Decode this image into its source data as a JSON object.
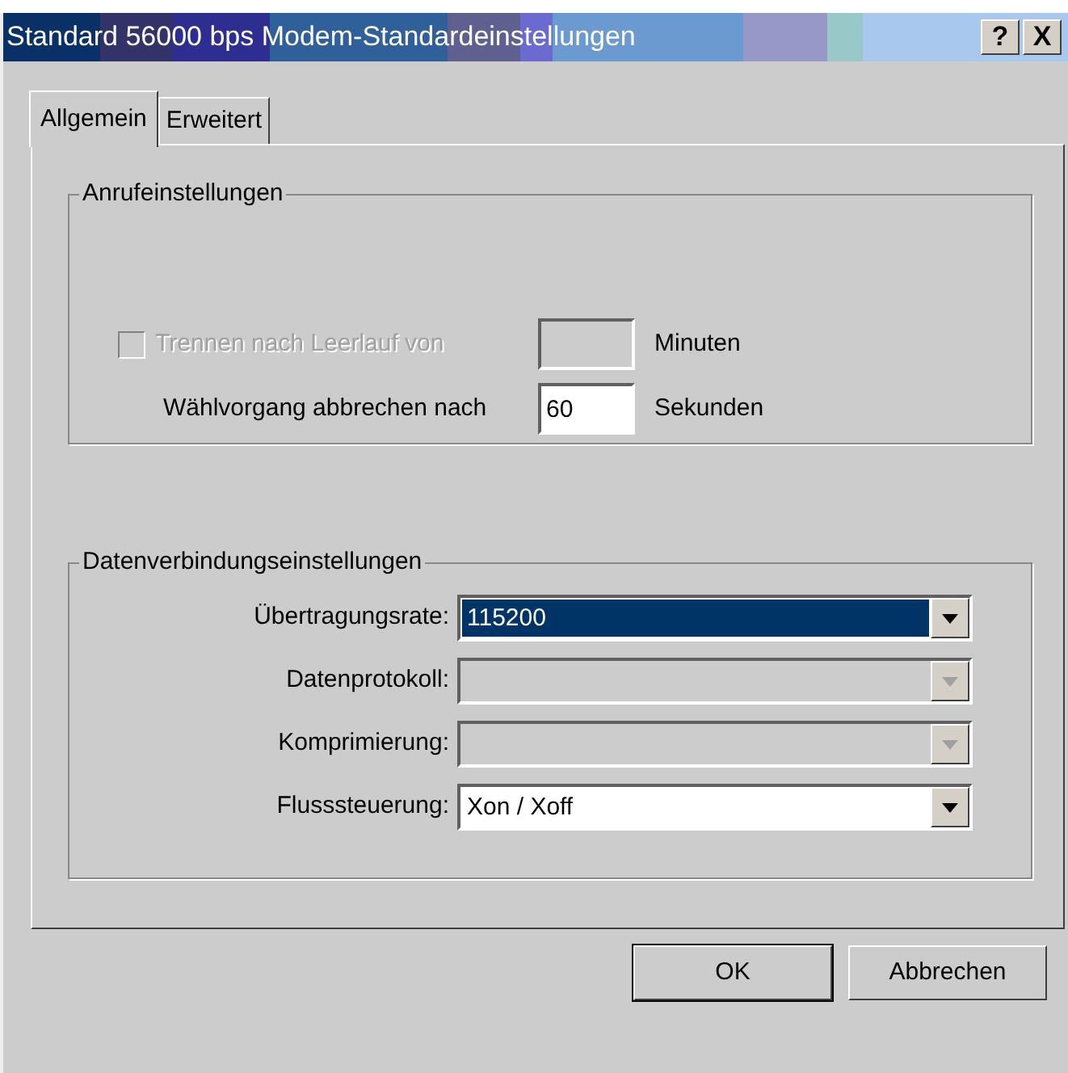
{
  "window": {
    "title": "Standard 56000 bps Modem-Standardeinstellungen",
    "title_buttons": [
      {
        "kind": "help",
        "label": "?"
      },
      {
        "kind": "close",
        "label": "X"
      }
    ]
  },
  "tabs": [
    {
      "label": "Allgemein",
      "selected": true
    },
    {
      "label": "Erweitert",
      "selected": false
    }
  ],
  "call_settings": {
    "title": "Anrufeinstellungen",
    "rows": [
      {
        "kind": "checkbox",
        "label": "Trennen nach Leerlauf von",
        "checked": false,
        "disabled": true,
        "unit": "Minuten"
      },
      {
        "kind": "plain",
        "label": "Wählvorgang abbrechen nach",
        "disabled": false,
        "value": "60",
        "unit": "Sekunden"
      }
    ]
  },
  "connection_settings": {
    "title": "Datenverbindungseinstellungen",
    "fields": [
      {
        "label": "Übertragungsrate:",
        "value": "115200",
        "disabled": false,
        "selected": true
      },
      {
        "label": "Datenprotokoll:",
        "disabled": true,
        "selected": false
      },
      {
        "label": "Komprimierung:",
        "disabled": true,
        "selected": false
      },
      {
        "label": "Flusssteuerung:",
        "value": "Xon / Xoff",
        "disabled": false,
        "selected": false
      }
    ]
  },
  "buttons": [
    {
      "label": "OK",
      "default": true
    },
    {
      "label": "Abbrechen",
      "default": false
    }
  ]
}
